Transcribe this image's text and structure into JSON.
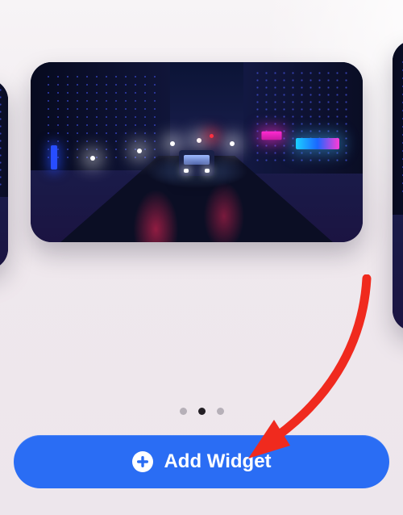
{
  "carousel": {
    "slides_visible": 3,
    "active_index": 1,
    "dots_total": 3
  },
  "add_button": {
    "label": "Add Widget"
  },
  "colors": {
    "accent": "#2a6df4",
    "arrow": "#f02a1e"
  }
}
